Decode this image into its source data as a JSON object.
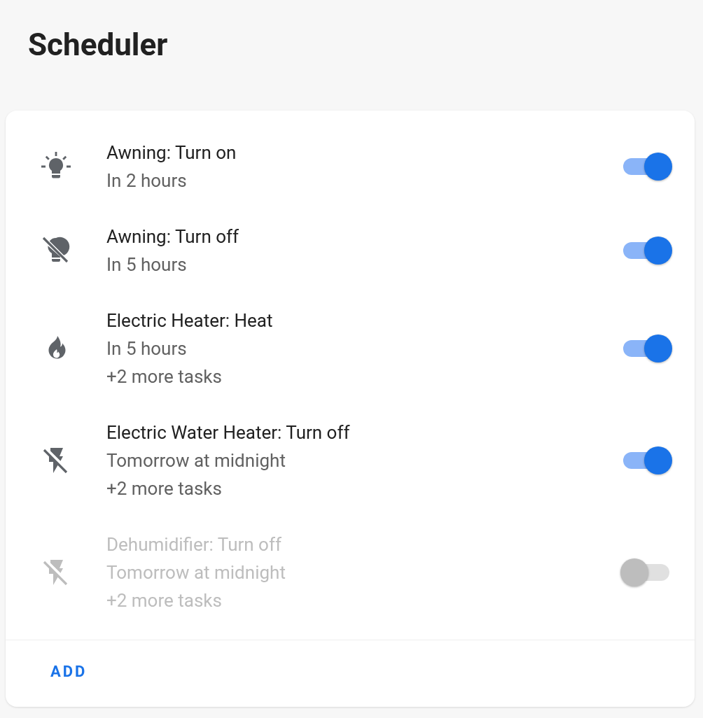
{
  "title": "Scheduler",
  "schedules": [
    {
      "kind": "bulb",
      "title": "Awning: Turn on",
      "lines": [
        "In 2 hours"
      ],
      "on": true
    },
    {
      "kind": "bulboff",
      "title": "Awning: Turn off",
      "lines": [
        "In 5 hours"
      ],
      "on": true
    },
    {
      "kind": "fire",
      "title": "Electric Heater: Heat",
      "lines": [
        "In 5 hours",
        "+2 more tasks"
      ],
      "on": true
    },
    {
      "kind": "flashoff",
      "title": "Electric Water Heater: Turn off",
      "lines": [
        "Tomorrow at midnight",
        "+2 more tasks"
      ],
      "on": true
    },
    {
      "kind": "flashoff",
      "title": "Dehumidifier: Turn off",
      "lines": [
        "Tomorrow at midnight",
        "+2 more tasks"
      ],
      "on": false
    }
  ],
  "add_button": "ADD"
}
